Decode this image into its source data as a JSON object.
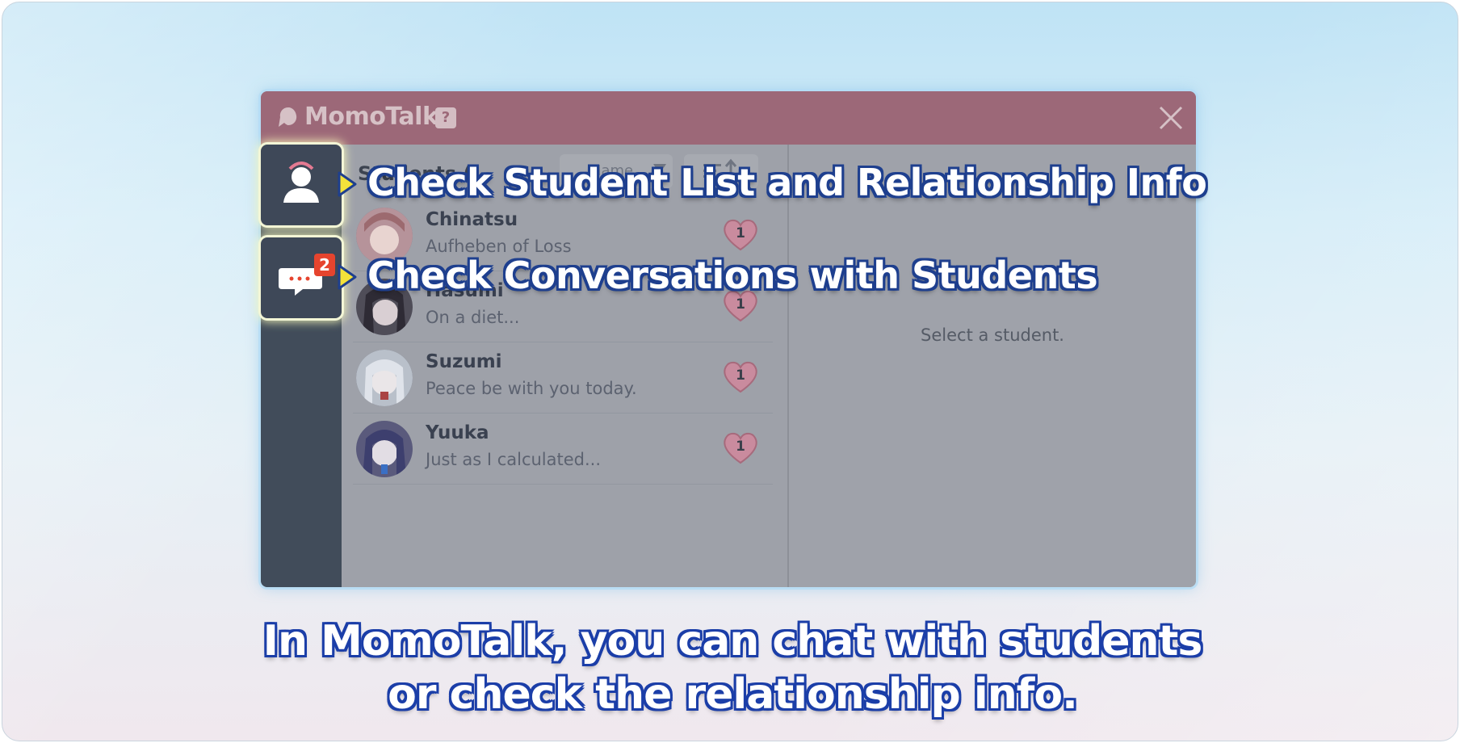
{
  "window": {
    "title": "MomoTalk",
    "help_label": "?"
  },
  "list": {
    "title": "Students (",
    "sort_label": "Name"
  },
  "students": [
    {
      "name": "Chinatsu",
      "status": "Aufheben of Loss",
      "relationship": "1"
    },
    {
      "name": "Hasumi",
      "status": "On a diet...",
      "relationship": "1"
    },
    {
      "name": "Suzumi",
      "status": "Peace be with you today.",
      "relationship": "1"
    },
    {
      "name": "Yuuka",
      "status": "Just as I calculated...",
      "relationship": "1"
    }
  ],
  "detail": {
    "empty_message": "Select a student."
  },
  "nav": {
    "messages_badge": "2"
  },
  "callouts": {
    "students": "Check Student List and Relationship Info",
    "conversations": "Check Conversations with Students"
  },
  "caption": {
    "line1": "In MomoTalk, you can chat with students",
    "line2": "or check the relationship info."
  },
  "colors": {
    "titlebar": "#9c6878",
    "sidenav": "#414c5a",
    "callout_text": "#ffffff",
    "callout_outline": "#1e3f8e",
    "arrow": "#f4e23a"
  }
}
